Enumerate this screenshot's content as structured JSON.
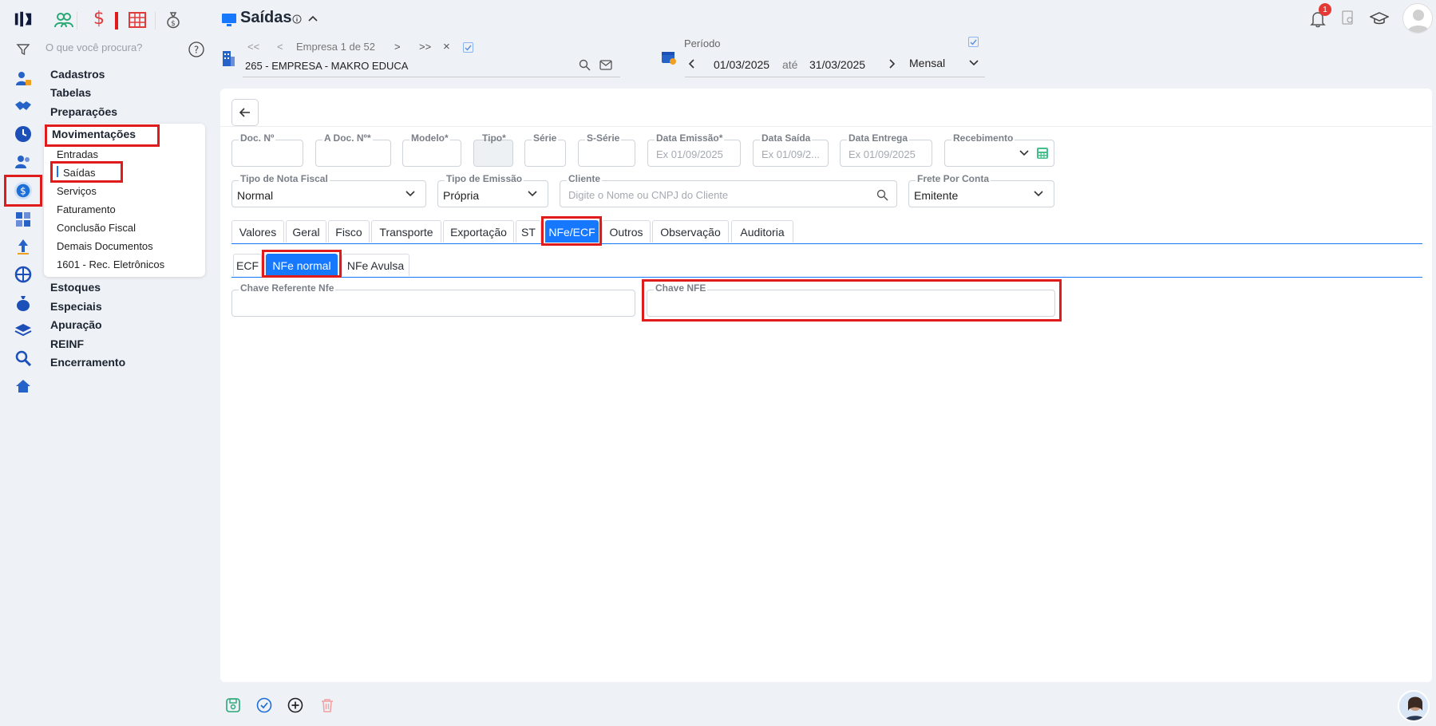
{
  "header": {
    "title": "Saídas",
    "company_nav": "Empresa 1 de 52",
    "company_value": "265 - EMPRESA - MAKRO EDUCA",
    "period_label": "Período",
    "period_start": "01/03/2025",
    "period_sep": "até",
    "period_end": "31/03/2025",
    "period_mode": "Mensal",
    "notification_count": "1"
  },
  "search": {
    "placeholder": "O que você procura?"
  },
  "menu": {
    "items": [
      "Cadastros",
      "Tabelas",
      "Preparações",
      "Movimentações",
      "Estoques",
      "Especiais",
      "Apuração",
      "REINF",
      "Encerramento"
    ],
    "sub_items": [
      "Entradas",
      "Saídas",
      "Serviços",
      "Faturamento",
      "Conclusão Fiscal",
      "Demais Documentos",
      "1601 - Rec. Eletrônicos"
    ]
  },
  "form": {
    "doc_no": "Doc. Nº",
    "a_doc_no": "A Doc. Nº*",
    "modelo": "Modelo*",
    "tipo": "Tipo*",
    "serie": "Série",
    "s_serie": "S-Série",
    "data_emissao": "Data Emissão*",
    "data_emissao_ph": "Ex 01/09/2025",
    "data_saida": "Data Saída",
    "data_saida_ph": "Ex 01/09/2...",
    "data_entrega": "Data Entrega",
    "data_entrega_ph": "Ex 01/09/2025",
    "recebimento": "Recebimento",
    "tipo_nota_label": "Tipo de Nota Fiscal",
    "tipo_nota_value": "Normal",
    "tipo_emissao_label": "Tipo de Emissão",
    "tipo_emissao_value": "Própria",
    "cliente_label": "Cliente",
    "cliente_ph": "Digite o Nome ou CNPJ do Cliente",
    "frete_label": "Frete Por Conta",
    "frete_value": "Emitente"
  },
  "tabs": [
    "Valores",
    "Geral",
    "Fisco",
    "Transporte",
    "Exportação",
    "ST",
    "NFe/ECF",
    "Outros",
    "Observação",
    "Auditoria"
  ],
  "subtabs": [
    "ECF",
    "NFe normal",
    "NFe Avulsa"
  ],
  "nfe": {
    "chave_ref_label": "Chave Referente Nfe",
    "chave_nfe_label": "Chave NFE"
  },
  "colors": {
    "accent": "#1677ff",
    "highlight": "#e01b1b"
  }
}
